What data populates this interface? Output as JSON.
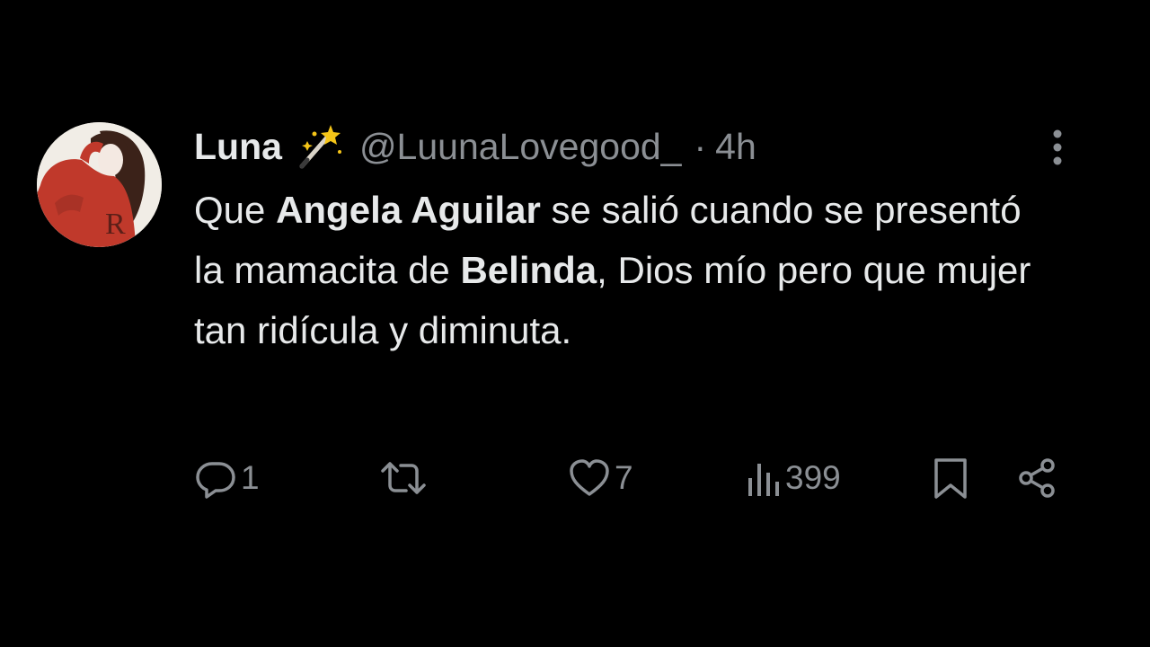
{
  "tweet": {
    "author_name": "Luna",
    "author_emoji_icon": "magic-wand-icon",
    "handle": "@LuunaLovegood_",
    "separator": "·",
    "time": "4h",
    "text_segments": [
      {
        "text": "Que ",
        "bold": false
      },
      {
        "text": "Angela Aguilar",
        "bold": true
      },
      {
        "text": " se salió cuando se presentó la mamacita de ",
        "bold": false
      },
      {
        "text": "Belinda",
        "bold": true
      },
      {
        "text": ", Dios mío pero que mujer tan ridícula y diminuta.",
        "bold": false
      }
    ]
  },
  "actions": {
    "reply_count": "1",
    "retweet_count": "",
    "like_count": "7",
    "views_count": "399"
  },
  "icons": {
    "reply": "reply-icon",
    "retweet": "retweet-icon",
    "like": "heart-icon",
    "views": "views-icon",
    "bookmark": "bookmark-icon",
    "share": "share-icon",
    "more": "more-options-icon"
  },
  "colors": {
    "background": "#000000",
    "primary_text": "#e7e9ea",
    "secondary_text": "#8b8f94",
    "avatar_sweater": "#c0392b"
  }
}
